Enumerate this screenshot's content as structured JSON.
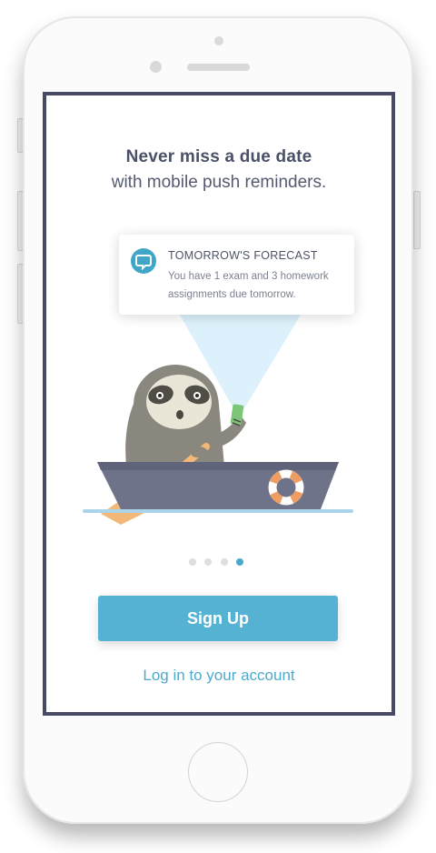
{
  "onboarding": {
    "headline": "Never miss a due date",
    "subheadline": "with mobile push reminders."
  },
  "notification": {
    "icon": "chat-bubble-icon",
    "title": "TOMORROW'S FORECAST",
    "body": "You have 1 exam and 3 homework assignments due tomorrow."
  },
  "pagination": {
    "total": 4,
    "active_index": 4
  },
  "actions": {
    "signup_label": "Sign Up",
    "login_label": "Log in to your account"
  },
  "colors": {
    "accent": "#55b2d2",
    "link": "#4ea9cb",
    "text_dark": "#4a5068",
    "screen_border": "#464b63",
    "boat": "#6e7389",
    "paddle": "#f2b877",
    "sloth_fur": "#8a877e",
    "water": "#a9d4ea"
  }
}
